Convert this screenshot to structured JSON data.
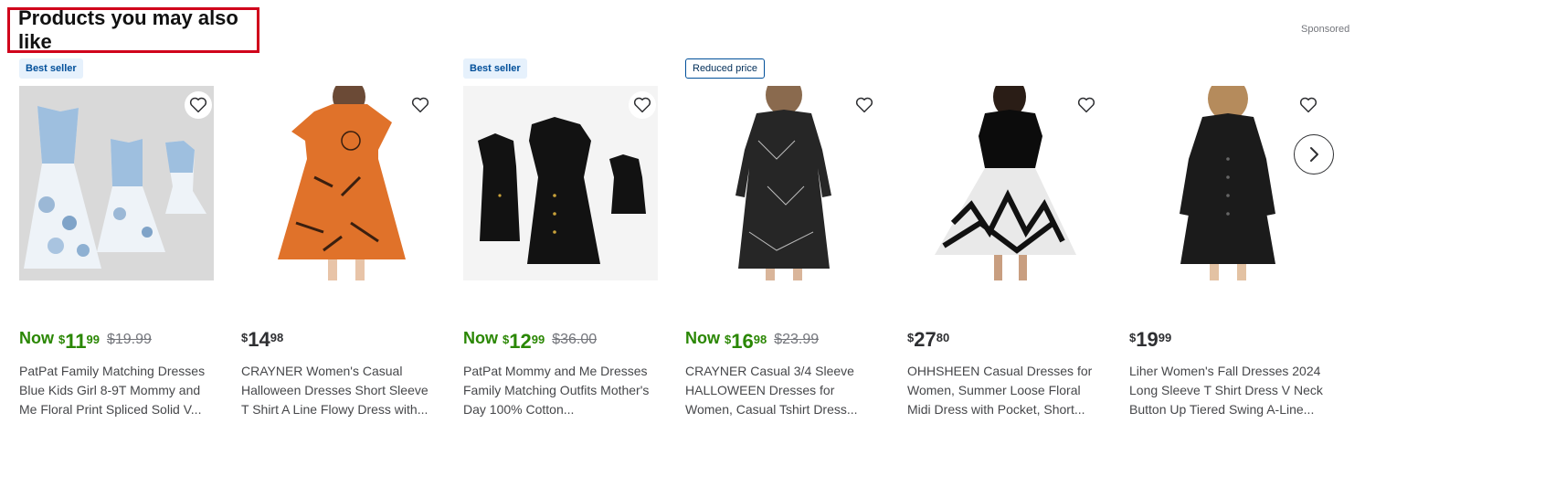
{
  "section": {
    "title": "Products you may also like",
    "sponsored": "Sponsored"
  },
  "products": [
    {
      "badge": "Best seller",
      "now_label": "Now",
      "currency": "$",
      "dollars": "11",
      "cents": "99",
      "was": "$19.99",
      "title": "PatPat Family Matching Dresses Blue Kids Girl 8-9T Mommy and Me Floral Print Spliced Solid V...",
      "favorite_icon": "heart-outline-icon"
    },
    {
      "badge": "",
      "now_label": "",
      "currency": "$",
      "dollars": "14",
      "cents": "98",
      "was": "",
      "title": "CRAYNER Women's Casual Halloween Dresses Short Sleeve T Shirt A Line Flowy Dress with...",
      "favorite_icon": "heart-outline-icon"
    },
    {
      "badge": "Best seller",
      "now_label": "Now",
      "currency": "$",
      "dollars": "12",
      "cents": "99",
      "was": "$36.00",
      "title": "PatPat Mommy and Me Dresses Family Matching Outfits Mother's Day 100% Cotton...",
      "favorite_icon": "heart-outline-icon"
    },
    {
      "badge": "Reduced price",
      "now_label": "Now",
      "currency": "$",
      "dollars": "16",
      "cents": "98",
      "was": "$23.99",
      "title": "CRAYNER Casual 3/4 Sleeve HALLOWEEN Dresses for Women, Casual Tshirt Dress...",
      "favorite_icon": "heart-outline-icon"
    },
    {
      "badge": "",
      "now_label": "",
      "currency": "$",
      "dollars": "27",
      "cents": "80",
      "was": "",
      "title": "OHHSHEEN Casual Dresses for Women, Summer Loose Floral Midi Dress with Pocket, Short...",
      "favorite_icon": "heart-outline-icon"
    },
    {
      "badge": "",
      "now_label": "",
      "currency": "$",
      "dollars": "19",
      "cents": "99",
      "was": "",
      "title": "Liher Women's Fall Dresses 2024 Long Sleeve T Shirt Dress V Neck Button Up Tiered Swing A-Line...",
      "favorite_icon": "heart-outline-icon"
    }
  ],
  "carousel": {
    "next_icon": "chevron-right-icon"
  },
  "colors": {
    "accent_green": "#2a8703",
    "highlight_red": "#d0021b",
    "badge_blue_bg": "#e6f1fc"
  }
}
